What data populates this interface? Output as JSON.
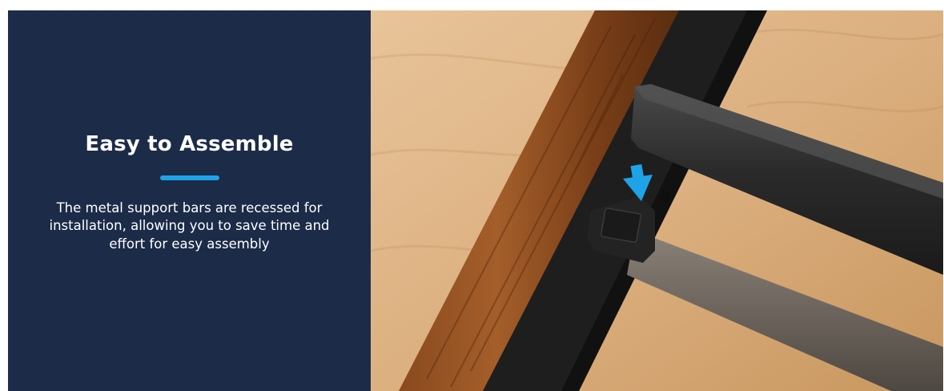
{
  "feature": {
    "title": "Easy to Assemble",
    "description": "The metal support bars are recessed for installation, allowing you to save time and effort for easy assembly"
  },
  "colors": {
    "panel_background": "#1b2b48",
    "accent": "#1fa3e8",
    "text": "#ffffff"
  },
  "image": {
    "subject": "bed-frame-support-bar-joint",
    "arrow_icon": "arrow-down-icon"
  }
}
